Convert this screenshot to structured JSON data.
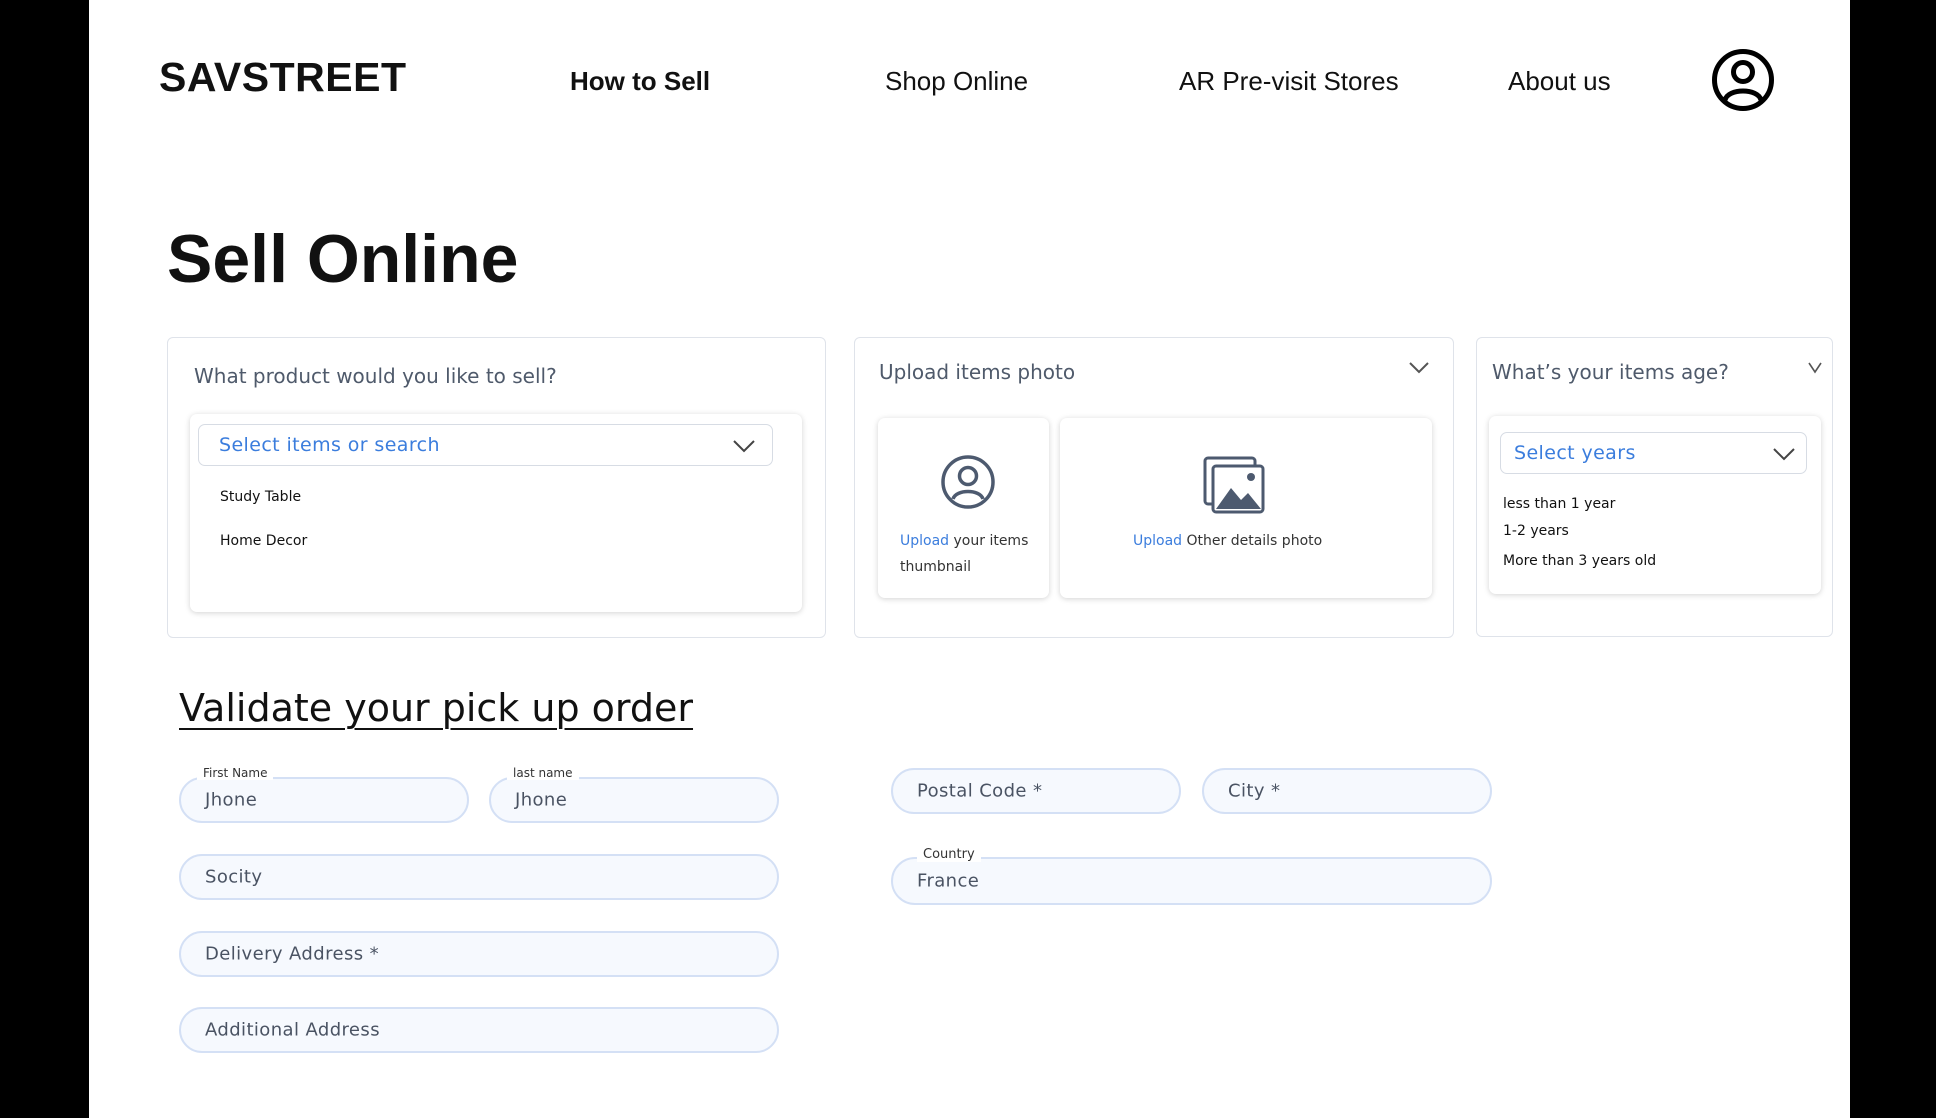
{
  "header": {
    "brand": "SAVSTREET",
    "nav": [
      "How to Sell",
      "Shop Online",
      "AR Pre-visit Stores",
      "About us"
    ]
  },
  "page_title": "Sell Online",
  "product_card": {
    "title": "What product would you like to sell?",
    "select_placeholder": "Select items or search",
    "options": [
      "Study Table",
      "Home Decor"
    ]
  },
  "photo_card": {
    "title": "Upload items photo",
    "thumb_link": "Upload",
    "thumb_text_1": " your items",
    "thumb_text_2": "thumbnail",
    "other_link": "Upload",
    "other_text": " Other details photo"
  },
  "age_card": {
    "title": "What’s your items age?",
    "select_placeholder": "Select years",
    "options": [
      "less than 1 year",
      "1-2 years",
      "More than 3 years old"
    ]
  },
  "validate": {
    "title": "Validate your pick up order",
    "first_name_label": "First Name",
    "first_name_value": "Jhone",
    "last_name_label": "last name",
    "last_name_value": "Jhone",
    "socity_placeholder": "Socity",
    "delivery_placeholder": "Delivery Address *",
    "additional_placeholder": "Additional Address",
    "postal_placeholder": "Postal Code *",
    "city_placeholder": "City *",
    "country_label": "Country",
    "country_value": "France"
  },
  "colors": {
    "accent": "#3b7ddd",
    "field_border": "#d4e0f5",
    "field_bg": "#f6f9fe",
    "icon_slate": "#4d5a6f"
  }
}
